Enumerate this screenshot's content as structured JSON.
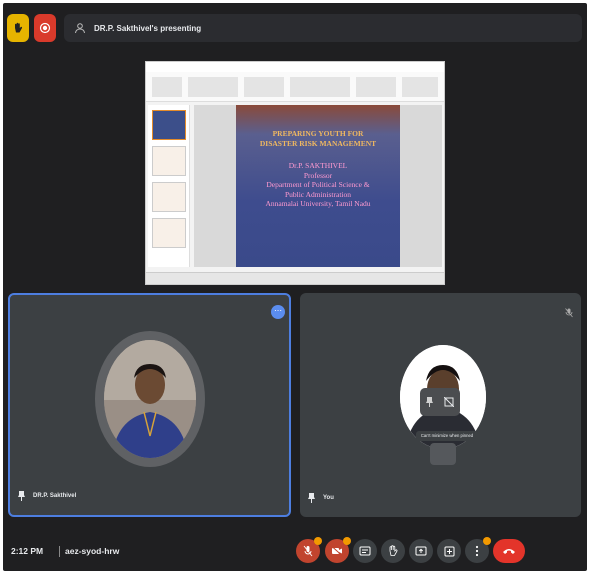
{
  "top_bar": {
    "presenting_text": "DR.P. Sakthivel's presenting"
  },
  "slide": {
    "title_lines": [
      "PREPARING YOUTH FOR",
      "DISASTER RISK MANAGEMENT"
    ],
    "body_lines": [
      "Dr.P. SAKTHIVEL",
      "Professor",
      "Department of Political Science &",
      "Public Administration",
      "Annamalai University, Tamil Nadu"
    ]
  },
  "tiles": {
    "left_name": "DR.P. Sakthivel",
    "right_name": "You",
    "tooltip": "Can't minimize when pinned"
  },
  "bottom_bar": {
    "time": "2:12 PM",
    "meeting_code": "aez-syod-hrw"
  },
  "colors": {
    "frame_bg": "#1f1f21",
    "tile_bg": "#3c4043",
    "active_border": "#4d7ee0",
    "hangup_red": "#e3342a"
  }
}
